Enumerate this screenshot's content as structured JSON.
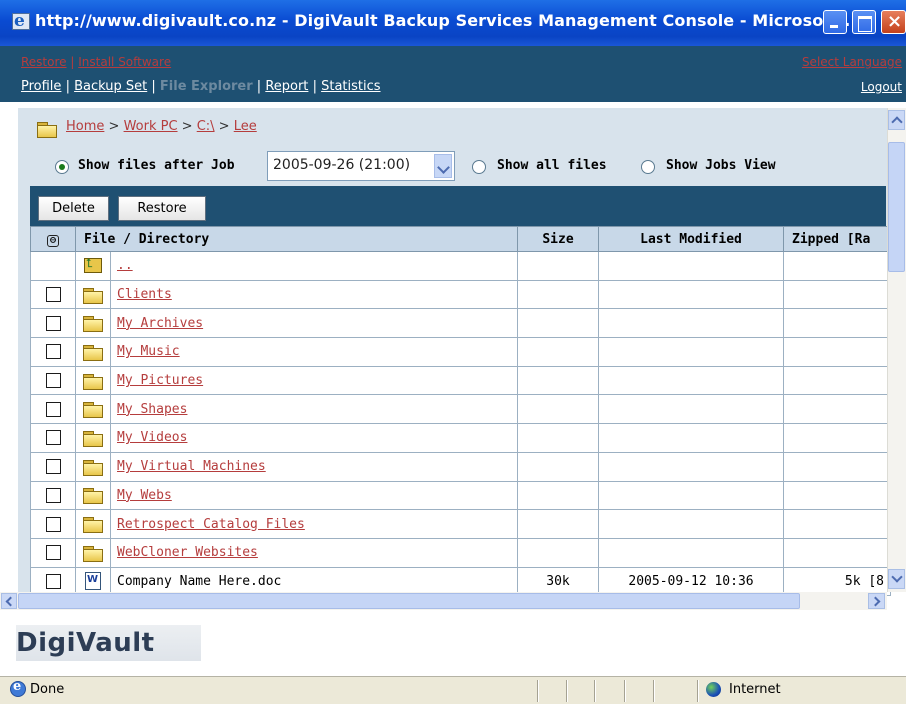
{
  "window": {
    "title": "http://www.digivault.co.nz - DigiVault Backup Services Management Console - Microsoft..."
  },
  "nav": {
    "restore": "Restore",
    "separator": "|",
    "install_software": "Install Software",
    "select_language": "Select Language",
    "profile": "Profile",
    "backup_set": "Backup Set",
    "file_explorer": "File Explorer",
    "report": "Report",
    "statistics": "Statistics",
    "logout": "Logout"
  },
  "breadcrumb": {
    "items": [
      "Home",
      "Work PC",
      "C:\\",
      "Lee"
    ],
    "sep": " > "
  },
  "view_options": {
    "show_after_label": "Show files after Job",
    "selected_job": "2005-09-26 (21:00)",
    "show_all_label": "Show all files",
    "show_jobs_label": "Show Jobs View",
    "selected": "show_after"
  },
  "toolbar": {
    "delete_label": "Delete",
    "restore_label": "Restore"
  },
  "table": {
    "collapse_glyph": "⊖",
    "columns": [
      "File / Directory",
      "Size",
      "Last Modified",
      "Zipped [Ra"
    ],
    "rows": [
      {
        "name": "..",
        "type": "up",
        "size": "",
        "modified": "",
        "zipped": ""
      },
      {
        "name": "Clients",
        "type": "folder",
        "size": "",
        "modified": "",
        "zipped": ""
      },
      {
        "name": "My Archives",
        "type": "folder",
        "size": "",
        "modified": "",
        "zipped": ""
      },
      {
        "name": "My Music",
        "type": "folder",
        "size": "",
        "modified": "",
        "zipped": ""
      },
      {
        "name": "My Pictures",
        "type": "folder",
        "size": "",
        "modified": "",
        "zipped": ""
      },
      {
        "name": "My Shapes",
        "type": "folder",
        "size": "",
        "modified": "",
        "zipped": ""
      },
      {
        "name": "My Videos",
        "type": "folder",
        "size": "",
        "modified": "",
        "zipped": ""
      },
      {
        "name": "My Virtual Machines",
        "type": "folder",
        "size": "",
        "modified": "",
        "zipped": ""
      },
      {
        "name": "My Webs",
        "type": "folder",
        "size": "",
        "modified": "",
        "zipped": ""
      },
      {
        "name": "Retrospect Catalog Files",
        "type": "folder",
        "size": "",
        "modified": "",
        "zipped": ""
      },
      {
        "name": "WebCloner Websites",
        "type": "folder",
        "size": "",
        "modified": "",
        "zipped": ""
      },
      {
        "name": "Company Name Here.doc",
        "type": "doc",
        "size": "30k",
        "modified": "2005-09-12 10:36",
        "zipped": "5k [8"
      }
    ]
  },
  "logo": {
    "text": "DigiVault"
  },
  "status": {
    "text": "Done",
    "zone": "Internet"
  },
  "colors": {
    "title_bar": "#0a4bd2",
    "nav_bar": "#1e5072",
    "link_red": "#b53d3d",
    "content_bg": "#d8e3ec"
  }
}
